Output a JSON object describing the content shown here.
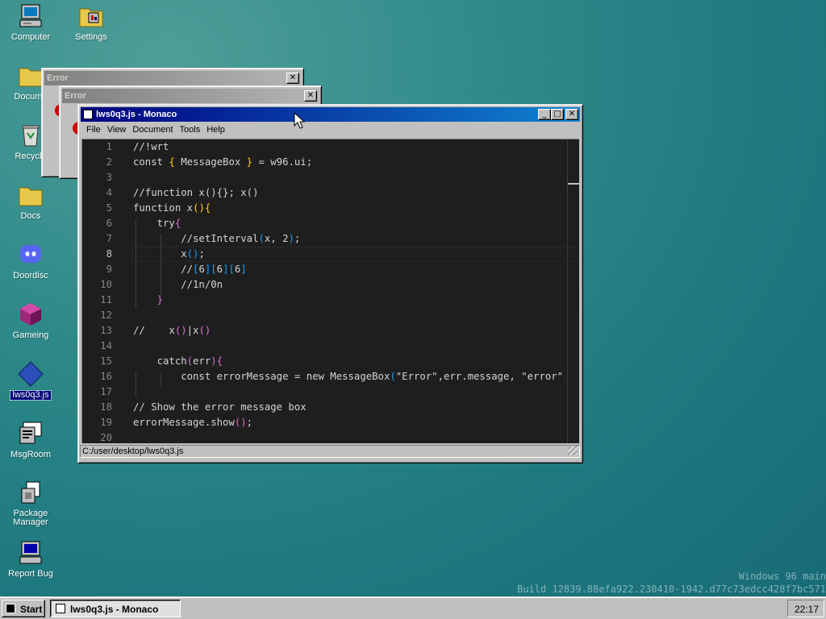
{
  "desktop": {
    "icons": [
      {
        "label": "Computer"
      },
      {
        "label": "Settings"
      },
      {
        "label": "Docume"
      },
      {
        "label": "Recycle"
      },
      {
        "label": "Docs"
      },
      {
        "label": "Doordisc"
      },
      {
        "label": "Gameing"
      },
      {
        "label": "lws0q3.js"
      },
      {
        "label": "MsgRoom"
      },
      {
        "label": "Package Manager"
      },
      {
        "label": "Report Bug"
      }
    ]
  },
  "error_windows": [
    {
      "title": "Error",
      "close": "✕"
    },
    {
      "title": "Error",
      "close": "✕"
    }
  ],
  "editor_window": {
    "title": "lws0q3.js - Monaco",
    "buttons": {
      "minimize": "_",
      "maximize": "□",
      "close": "✕"
    },
    "menu": [
      "File",
      "View",
      "Document",
      "Tools",
      "Help"
    ],
    "current_line": 8,
    "lines": [
      {
        "n": "1",
        "segments": [
          {
            "t": "//!wrt"
          }
        ]
      },
      {
        "n": "2",
        "segments": [
          {
            "t": "const "
          },
          {
            "t": "{",
            "c": "p1"
          },
          {
            "t": " MessageBox "
          },
          {
            "t": "}",
            "c": "p1"
          },
          {
            "t": " = w96.ui;"
          }
        ]
      },
      {
        "n": "3",
        "segments": []
      },
      {
        "n": "4",
        "segments": [
          {
            "t": "//function x(){}; x()"
          }
        ]
      },
      {
        "n": "5",
        "segments": [
          {
            "t": "function x"
          },
          {
            "t": "()",
            "c": "p1"
          },
          {
            "t": "{",
            "c": "p1"
          }
        ]
      },
      {
        "n": "6",
        "segments": [
          {
            "t": "    try"
          },
          {
            "t": "{",
            "c": "p2"
          }
        ]
      },
      {
        "n": "7",
        "segments": [
          {
            "t": "        //setInterval"
          },
          {
            "t": "(",
            "c": "p3"
          },
          {
            "t": "x, 2"
          },
          {
            "t": ")",
            "c": "p3"
          },
          {
            "t": ";"
          }
        ]
      },
      {
        "n": "8",
        "segments": [
          {
            "t": "        x"
          },
          {
            "t": "()",
            "c": "p3"
          },
          {
            "t": ";"
          }
        ]
      },
      {
        "n": "9",
        "segments": [
          {
            "t": "        //"
          },
          {
            "t": "[",
            "c": "p3"
          },
          {
            "t": "6"
          },
          {
            "t": "][",
            "c": "p3"
          },
          {
            "t": "6"
          },
          {
            "t": "][",
            "c": "p3"
          },
          {
            "t": "6"
          },
          {
            "t": "]",
            "c": "p3"
          }
        ]
      },
      {
        "n": "10",
        "segments": [
          {
            "t": "        //1n/0n"
          }
        ]
      },
      {
        "n": "11",
        "segments": [
          {
            "t": "    "
          },
          {
            "t": "}",
            "c": "p2"
          }
        ]
      },
      {
        "n": "12",
        "segments": []
      },
      {
        "n": "13",
        "segments": [
          {
            "t": "//    x"
          },
          {
            "t": "()",
            "c": "p2"
          },
          {
            "t": "|x"
          },
          {
            "t": "()",
            "c": "p2"
          }
        ]
      },
      {
        "n": "14",
        "segments": []
      },
      {
        "n": "15",
        "segments": [
          {
            "t": "    catch"
          },
          {
            "t": "(",
            "c": "p2"
          },
          {
            "t": "err"
          },
          {
            "t": ")",
            "c": "p2"
          },
          {
            "t": "{",
            "c": "p2"
          }
        ]
      },
      {
        "n": "16",
        "segments": [
          {
            "t": "        const errorMessage = new MessageBox"
          },
          {
            "t": "(",
            "c": "p3"
          },
          {
            "t": "\"Error\",err.message, \"error\""
          }
        ]
      },
      {
        "n": "17",
        "segments": []
      },
      {
        "n": "18",
        "segments": [
          {
            "t": "// Show the error message box"
          }
        ]
      },
      {
        "n": "19",
        "segments": [
          {
            "t": "errorMessage.show"
          },
          {
            "t": "()",
            "c": "p2"
          },
          {
            "t": ";"
          }
        ]
      },
      {
        "n": "20",
        "segments": []
      }
    ],
    "status_path": "C:/user/desktop/lws0q3.js"
  },
  "watermark": {
    "line1": "Windows 96 main",
    "line2": "Build 12839.88efa922.230410-1942.d77c73edcc428f7bc571"
  },
  "taskbar": {
    "start_label": "Start",
    "task_label": "lws0q3.js - Monaco",
    "clock": "22:17"
  },
  "colors": {
    "desktop": "#2f8a8a",
    "active_title_start": "#000080",
    "active_title_end": "#1084d0",
    "editor_bg": "#1e1e1e",
    "bracket_gold": "#ffd700",
    "bracket_orchid": "#da70d6",
    "bracket_blue": "#179fff"
  }
}
